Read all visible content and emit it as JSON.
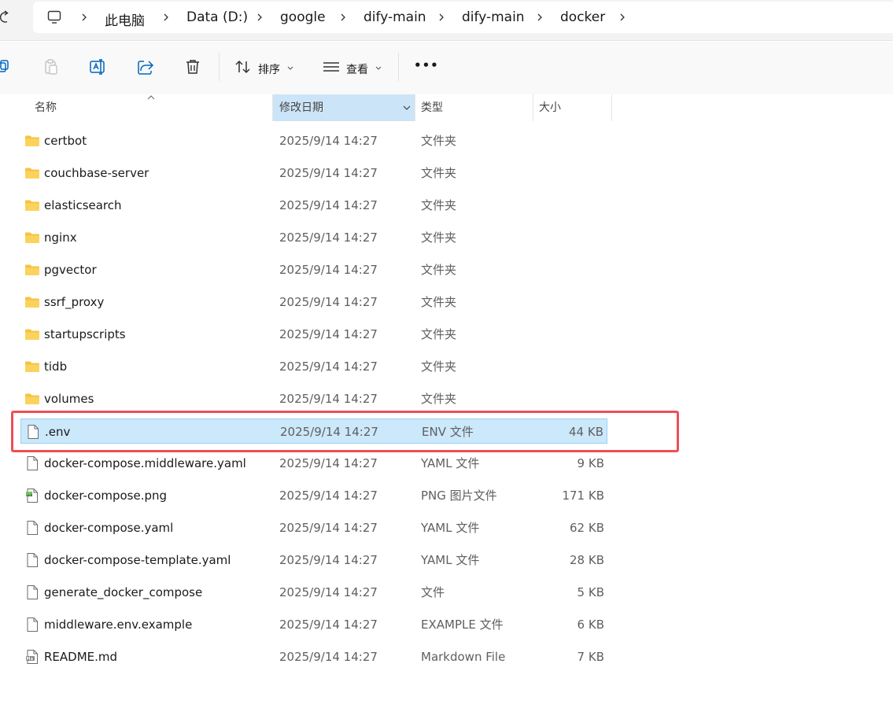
{
  "breadcrumb": [
    "此电脑",
    "Data (D:)",
    "google",
    "dify-main",
    "dify-main",
    "docker"
  ],
  "toolbar": {
    "sort_label": "排序",
    "view_label": "查看",
    "more_label": "•••"
  },
  "columns": {
    "name": "名称",
    "date": "修改日期",
    "type": "类型",
    "size": "大小"
  },
  "files": [
    {
      "name": "certbot",
      "date": "2025/9/14 14:27",
      "type": "文件夹",
      "size": "",
      "icon": "folder-icon"
    },
    {
      "name": "couchbase-server",
      "date": "2025/9/14 14:27",
      "type": "文件夹",
      "size": "",
      "icon": "folder-icon"
    },
    {
      "name": "elasticsearch",
      "date": "2025/9/14 14:27",
      "type": "文件夹",
      "size": "",
      "icon": "folder-icon"
    },
    {
      "name": "nginx",
      "date": "2025/9/14 14:27",
      "type": "文件夹",
      "size": "",
      "icon": "folder-icon"
    },
    {
      "name": "pgvector",
      "date": "2025/9/14 14:27",
      "type": "文件夹",
      "size": "",
      "icon": "folder-icon"
    },
    {
      "name": "ssrf_proxy",
      "date": "2025/9/14 14:27",
      "type": "文件夹",
      "size": "",
      "icon": "folder-icon"
    },
    {
      "name": "startupscripts",
      "date": "2025/9/14 14:27",
      "type": "文件夹",
      "size": "",
      "icon": "folder-icon"
    },
    {
      "name": "tidb",
      "date": "2025/9/14 14:27",
      "type": "文件夹",
      "size": "",
      "icon": "folder-icon"
    },
    {
      "name": "volumes",
      "date": "2025/9/14 14:27",
      "type": "文件夹",
      "size": "",
      "icon": "folder-icon"
    },
    {
      "name": ".env",
      "date": "2025/9/14 14:27",
      "type": "ENV 文件",
      "size": "44 KB",
      "icon": "file-icon"
    },
    {
      "name": "docker-compose.middleware.yaml",
      "date": "2025/9/14 14:27",
      "type": "YAML 文件",
      "size": "9 KB",
      "icon": "file-icon"
    },
    {
      "name": "docker-compose.png",
      "date": "2025/9/14 14:27",
      "type": "PNG 图片文件",
      "size": "171 KB",
      "icon": "image-file-icon"
    },
    {
      "name": "docker-compose.yaml",
      "date": "2025/9/14 14:27",
      "type": "YAML 文件",
      "size": "62 KB",
      "icon": "file-icon"
    },
    {
      "name": "docker-compose-template.yaml",
      "date": "2025/9/14 14:27",
      "type": "YAML 文件",
      "size": "28 KB",
      "icon": "file-icon"
    },
    {
      "name": "generate_docker_compose",
      "date": "2025/9/14 14:27",
      "type": "文件",
      "size": "5 KB",
      "icon": "file-icon"
    },
    {
      "name": "middleware.env.example",
      "date": "2025/9/14 14:27",
      "type": "EXAMPLE 文件",
      "size": "6 KB",
      "icon": "file-icon"
    },
    {
      "name": "README.md",
      "date": "2025/9/14 14:27",
      "type": "Markdown File",
      "size": "7 KB",
      "icon": "markdown-file-icon"
    }
  ],
  "selected_index": 9
}
